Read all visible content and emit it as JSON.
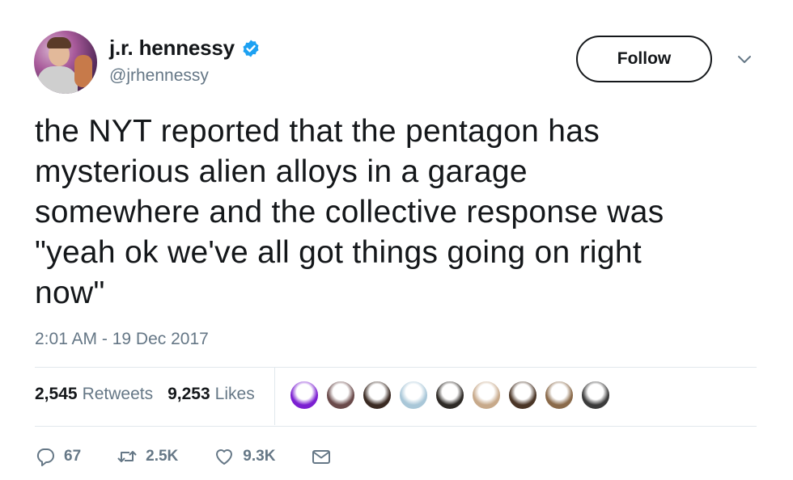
{
  "author": {
    "name": "j.r. hennessy",
    "handle": "@jrhennessy",
    "verified_icon": "verified-badge-icon"
  },
  "header": {
    "follow_label": "Follow",
    "caret_icon": "chevron-down-icon"
  },
  "tweet": {
    "lines": [
      "the NYT reported that the pentagon has",
      "mysterious alien alloys in a garage",
      "somewhere and the collective response was",
      "\"yeah ok we've all got things going on right",
      "now\""
    ],
    "timestamp": "2:01 AM - 19 Dec 2017"
  },
  "stats": {
    "retweets_count": "2,545",
    "retweets_label": "Retweets",
    "likes_count": "9,253",
    "likes_label": "Likes"
  },
  "liker_avatars": [
    {
      "color": "#7b1fd1"
    },
    {
      "color": "#6a4a4a"
    },
    {
      "color": "#3a2a22"
    },
    {
      "color": "#a9c7d8"
    },
    {
      "color": "#2e2a26"
    },
    {
      "color": "#c7a98a"
    },
    {
      "color": "#4a3526"
    },
    {
      "color": "#8a6a4a"
    },
    {
      "color": "#3b3b3b"
    }
  ],
  "actions": {
    "reply_count": "67",
    "retweet_count": "2.5K",
    "like_count": "9.3K"
  },
  "colors": {
    "verified_blue": "#1da1f2",
    "text_primary": "#14171a",
    "text_secondary": "#657786",
    "divider": "#e1e8ed"
  }
}
